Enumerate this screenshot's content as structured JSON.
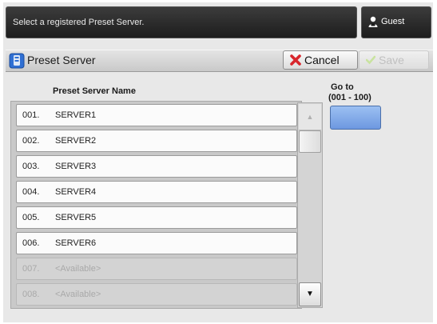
{
  "header": {
    "message": "Select a registered Preset Server.",
    "user_label": "Guest"
  },
  "title_bar": {
    "title": "Preset Server",
    "cancel_label": "Cancel",
    "save_label": "Save"
  },
  "list": {
    "column_header": "Preset Server Name",
    "rows": [
      {
        "num": "001.",
        "name": "SERVER1",
        "enabled": true
      },
      {
        "num": "002.",
        "name": "SERVER2",
        "enabled": true
      },
      {
        "num": "003.",
        "name": "SERVER3",
        "enabled": true
      },
      {
        "num": "004.",
        "name": "SERVER4",
        "enabled": true
      },
      {
        "num": "005.",
        "name": "SERVER5",
        "enabled": true
      },
      {
        "num": "006.",
        "name": "SERVER6",
        "enabled": true
      },
      {
        "num": "007.",
        "name": "<Available>",
        "enabled": false
      },
      {
        "num": "008.",
        "name": "<Available>",
        "enabled": false
      }
    ]
  },
  "goto": {
    "label": "Go to",
    "range": "(001 - 100)",
    "value": ""
  },
  "colors": {
    "accent_field": "#7ea6e8",
    "cancel_icon": "#d8262c",
    "save_icon_disabled": "#c9e3a0"
  },
  "icons": {
    "user": "user-icon",
    "title": "server-device-icon",
    "cancel": "cancel-x-icon",
    "save": "checkmark-icon",
    "scroll_up": "arrow-up-icon",
    "scroll_down": "arrow-down-icon"
  }
}
